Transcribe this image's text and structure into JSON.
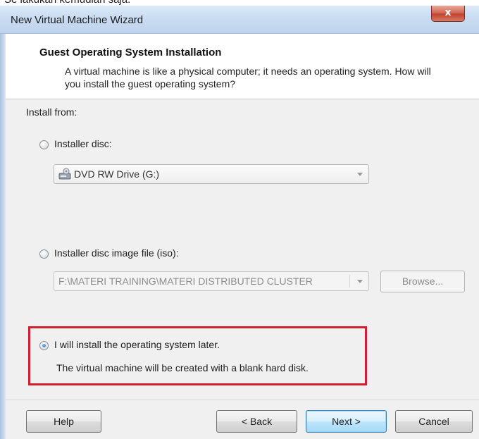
{
  "above_text": "Se lakukan kemudian saja.",
  "window": {
    "title": "New Virtual Machine Wizard",
    "close_glyph": "x"
  },
  "header": {
    "title": "Guest Operating System Installation",
    "description": "A virtual machine is like a physical computer; it needs an operating system. How will you install the guest operating system?"
  },
  "install_from": {
    "label": "Install from:",
    "options": [
      {
        "label": "Installer disc:",
        "selected": false
      },
      {
        "label": "Installer disc image file (iso):",
        "selected": false
      },
      {
        "label": "I will install the operating system later.",
        "selected": true
      }
    ],
    "disc_drive": {
      "value": "DVD RW Drive (G:)",
      "icon": "dvd-drive-icon"
    },
    "iso_path": {
      "value": "F:\\MATERI TRAINING\\MATERI DISTRIBUTED CLUSTER"
    },
    "browse_label": "Browse...",
    "later_note": "The virtual machine will be created with a blank hard disk."
  },
  "buttons": {
    "help": "Help",
    "back": "< Back",
    "next": "Next >",
    "cancel": "Cancel"
  },
  "colors": {
    "highlight_box": "#d21f2e",
    "title_bar": "#c9dcf2"
  }
}
